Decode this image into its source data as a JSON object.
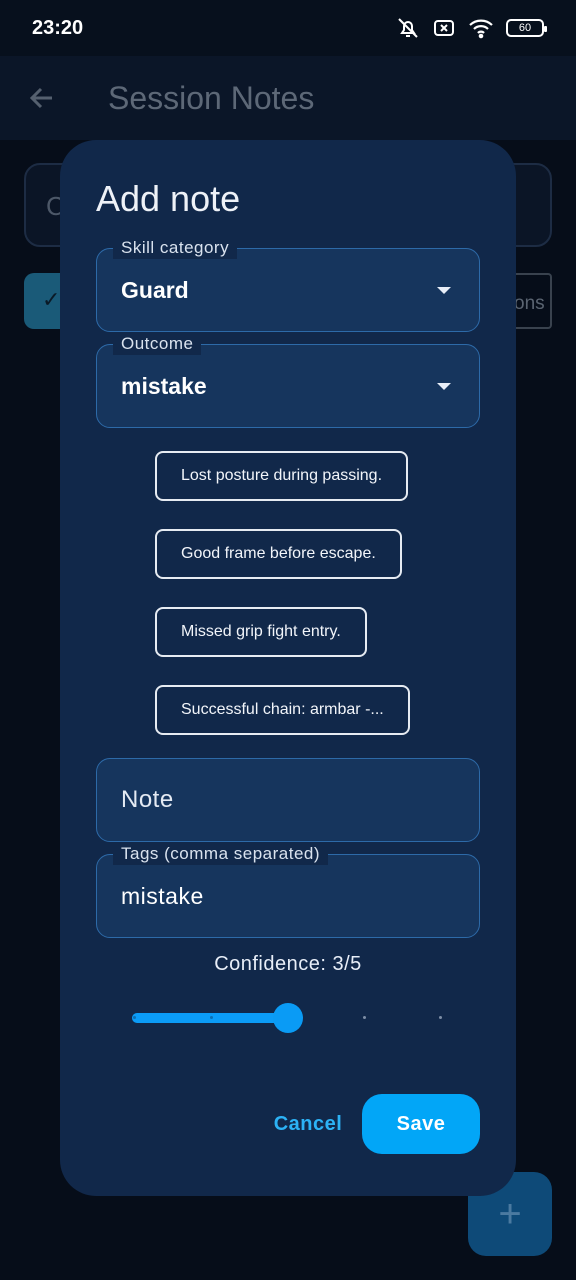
{
  "status_bar": {
    "time": "23:20",
    "battery": "60",
    "icons": [
      "mute-icon",
      "close-box-icon",
      "wifi-icon",
      "battery-icon"
    ]
  },
  "app_bar": {
    "title": "Session Notes",
    "back_icon": "arrow-left-icon"
  },
  "background": {
    "search_text": "C",
    "chip_right_text": "ons",
    "chip_left_icon": "checkmark-icon",
    "fab_icon": "plus-icon"
  },
  "dialog": {
    "title": "Add note",
    "skill_category": {
      "label": "Skill category",
      "value": "Guard"
    },
    "outcome": {
      "label": "Outcome",
      "value": "mistake"
    },
    "suggestions": [
      "Lost posture during passing.",
      "Good frame before escape.",
      "Missed grip fight entry.",
      "Successful chain: armbar -..."
    ],
    "note": {
      "placeholder": "Note"
    },
    "tags": {
      "label": "Tags (comma separated)",
      "value": "mistake"
    },
    "confidence": {
      "label": "Confidence: 3/5",
      "value": 3,
      "min": 1,
      "max": 5
    },
    "buttons": {
      "cancel": "Cancel",
      "save": "Save"
    }
  },
  "colors": {
    "dialog_bg": "#11284a",
    "field_bg": "#16355d",
    "field_border": "#2d6aa8",
    "accent": "#02a6f7",
    "cancel_text": "#2cb2f5",
    "page_bg": "#060d19"
  }
}
